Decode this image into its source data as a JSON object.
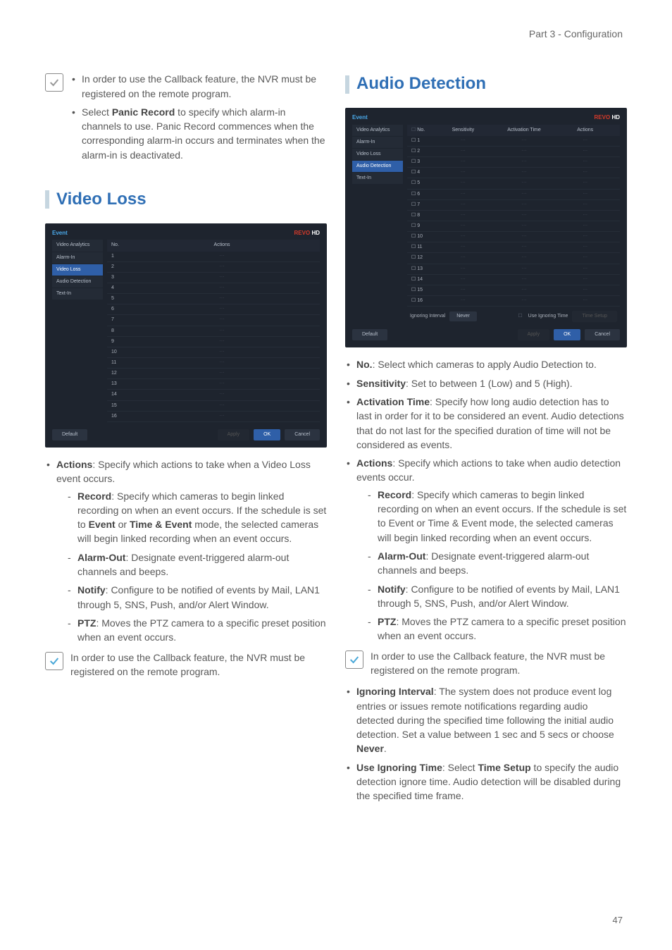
{
  "header": {
    "breadcrumb": "Part 3 - Configuration"
  },
  "pageNumber": "47",
  "leftCol": {
    "introBullets": [
      {
        "text": "In order to use the Callback feature, the NVR must be registered on the remote program."
      },
      {
        "prefix": "Select ",
        "bold1": "Panic Record",
        "text": " to specify which alarm-in channels to use. Panic Record commences when the corresponding alarm-in occurs and terminates when the alarm-in is deactivated."
      }
    ],
    "section": {
      "title": "Video Loss"
    },
    "screenshot": {
      "panel": "Event",
      "side": [
        "Video Analytics",
        "Alarm-In",
        "Video Loss",
        "Audio Detection",
        "Text-In"
      ],
      "selected": "Video Loss",
      "cols": [
        "No.",
        "Actions"
      ],
      "rows": [
        "1",
        "2",
        "3",
        "4",
        "5",
        "6",
        "7",
        "8",
        "9",
        "10",
        "11",
        "12",
        "13",
        "14",
        "15",
        "16"
      ],
      "buttons": {
        "default": "Default",
        "apply": "Apply",
        "ok": "OK",
        "cancel": "Cancel"
      },
      "logo": "REVO",
      "logoHD": "HD"
    },
    "actions": {
      "lead_bold": "Actions",
      "lead_text": ": Specify which actions to take when a Video Loss event occurs.",
      "items": [
        {
          "bold": "Record",
          "text": ": Specify which cameras to begin linked recording on when an event occurs. If the schedule is set to ",
          "bold2": "Event",
          "mid": " or ",
          "bold3": "Time & Event",
          "tail": " mode, the selected cameras will begin linked recording when an event occurs."
        },
        {
          "bold": "Alarm-Out",
          "text": ": Designate event-triggered alarm-out channels and beeps."
        },
        {
          "bold": "Notify",
          "text": ": Configure to be notified of events by Mail, LAN1 through 5, SNS, Push, and/or Alert Window."
        },
        {
          "bold": "PTZ",
          "text": ": Moves the PTZ camera to a specific preset position when an event occurs."
        }
      ]
    },
    "note2": "In order to use the Callback feature, the NVR must be registered on the remote program."
  },
  "rightCol": {
    "section": {
      "title": "Audio Detection"
    },
    "screenshot": {
      "panel": "Event",
      "side": [
        "Video Analytics",
        "Alarm-In",
        "Video Loss",
        "Audio Detection",
        "Text-In"
      ],
      "selected": "Audio Detection",
      "cols": [
        "No.",
        "Sensitivity",
        "Activation Time",
        "Actions"
      ],
      "rows": [
        "1",
        "2",
        "3",
        "4",
        "5",
        "6",
        "7",
        "8",
        "9",
        "10",
        "11",
        "12",
        "13",
        "14",
        "15",
        "16"
      ],
      "extra": {
        "ignoringLabel": "Ignoring Interval",
        "ignoringValue": "Never",
        "useIgnoring": "Use Ignoring Time",
        "timeSetup": "Time Setup"
      },
      "buttons": {
        "default": "Default",
        "apply": "Apply",
        "ok": "OK",
        "cancel": "Cancel"
      },
      "logo": "REVO",
      "logoHD": "HD"
    },
    "bullets": [
      {
        "bold": "No.",
        "text": ": Select which cameras to apply Audio Detection to."
      },
      {
        "bold": "Sensitivity",
        "text": ": Set to between 1 (Low) and 5 (High)."
      },
      {
        "bold": "Activation Time",
        "text": ": Specify how long audio detection has to last in order for it to be considered an event. Audio detections that do not last for the specified duration of time will not be considered as events."
      }
    ],
    "actions": {
      "lead_bold": "Actions",
      "lead_text": ": Specify which actions to take when audio detection events occur.",
      "items": [
        {
          "bold": "Record",
          "text": ": Specify which cameras to begin linked recording on when an event occurs. If the schedule is set to Event or Time & Event mode, the selected cameras will begin linked recording when an event occurs."
        },
        {
          "bold": "Alarm-Out",
          "text": ": Designate event-triggered alarm-out channels and beeps."
        },
        {
          "bold": "Notify",
          "text": ": Configure to be notified of events by Mail, LAN1 through 5, SNS, Push, and/or Alert Window."
        },
        {
          "bold": "PTZ",
          "text": ": Moves the PTZ camera to a specific preset position when an event occurs."
        }
      ]
    },
    "note": "In order to use the Callback feature, the NVR must be registered on the remote program.",
    "bullets2": [
      {
        "bold": "Ignoring Interval",
        "text": ": The system does not produce event log entries or issues remote notifications regarding audio detected during the specified time following the initial audio detection. Set a value between 1 sec and 5 secs or choose ",
        "bold2": "Never",
        "tail": "."
      },
      {
        "bold": "Use Ignoring Time",
        "text": ": Select ",
        "bold2": "Time Setup",
        "tail": " to specify the audio detection ignore time. Audio detection will be disabled during the specified time frame."
      }
    ]
  }
}
